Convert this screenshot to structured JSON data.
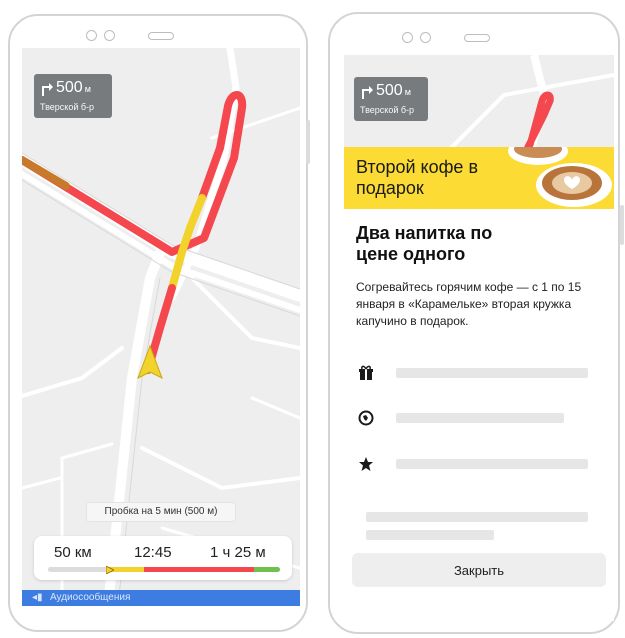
{
  "navigator": {
    "maneuver": {
      "distance": "500",
      "unit": "м",
      "street": "Тверской б-р"
    },
    "traffic_notice": "Пробка на 5 мин (500 м)",
    "trip": {
      "remaining_distance": "50 км",
      "arrival_time": "12:45",
      "remaining_time": "1 ч 25 м"
    },
    "bottom_bar_label": "Аудиосообщения"
  },
  "promo": {
    "maneuver": {
      "distance": "500",
      "unit": "м",
      "street": "Тверской б-р"
    },
    "banner_title": "Второй кофе в подарок",
    "offer_title": "Два напитка по цене одного",
    "offer_description": "Согревайтесь горячим кофе — с 1 по 15 января в «Карамельке» вторая кружка капучино в подарок.",
    "detail_icons": [
      "gift-icon",
      "globe-icon",
      "star-icon"
    ],
    "close_label": "Закрыть"
  },
  "colors": {
    "route_red": "#f4474e",
    "route_yellow": "#f2d32c",
    "route_green": "#6ec24c",
    "banner_yellow": "#fbdb34",
    "bottom_bar_blue": "#3d7ce0",
    "turn_card_gray": "#777b7e"
  }
}
